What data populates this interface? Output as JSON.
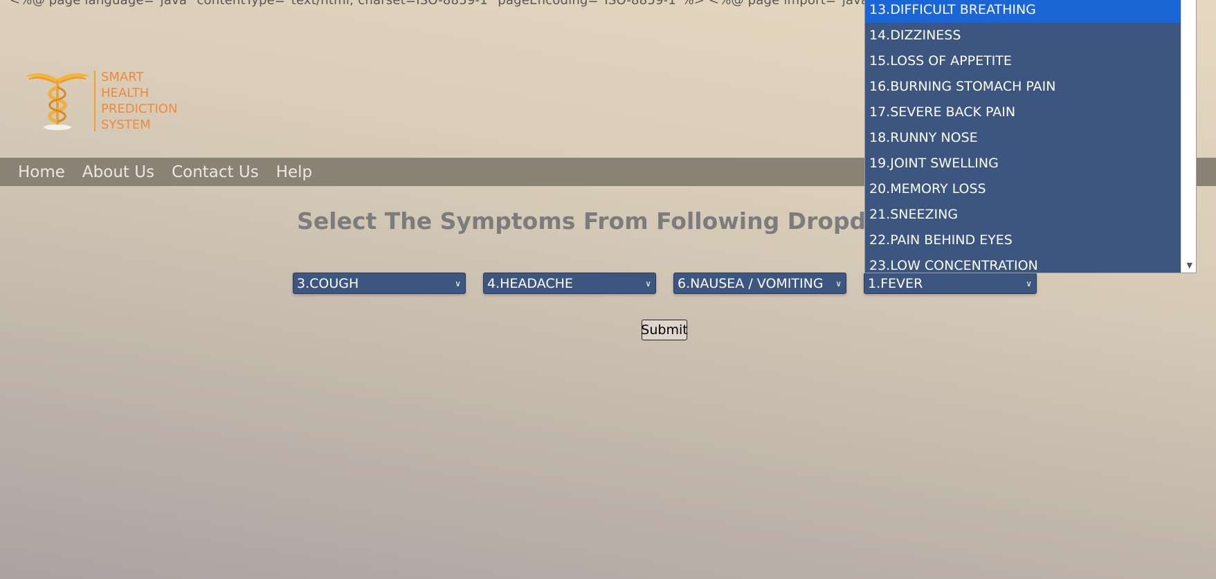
{
  "source_leak": "<%@ page language=\"java\" contentType=\"text/html; charset=ISO-8859-1\" pageEncoding=\"ISO-8859-1\"%>   <%@ page import=\"java.util.",
  "logo": {
    "line1": "SMART",
    "line2": "HEALTH",
    "line3": "PREDICTION",
    "line4": "SYSTEM",
    "accent_color": "#ef8a3a"
  },
  "nav": {
    "home": "Home",
    "about": "About Us",
    "contact": "Contact Us",
    "help": "Help"
  },
  "heading": "Select The Symptoms From Following Dropdown",
  "selects": [
    {
      "value": "3.COUGH"
    },
    {
      "value": "4.HEADACHE"
    },
    {
      "value": "6.NAUSEA / VOMITING"
    },
    {
      "value": "1.FEVER"
    }
  ],
  "submit_label": "Submit",
  "dropdown": {
    "options": [
      "13.DIFFICULT BREATHING",
      "14.DIZZINESS",
      "15.LOSS OF APPETITE",
      "16.BURNING STOMACH PAIN",
      "17.SEVERE BACK PAIN",
      "18.RUNNY NOSE",
      "19.JOINT SWELLING",
      "20.MEMORY LOSS",
      "21.SNEEZING",
      "22.PAIN BEHIND EYES",
      "23.LOW CONCENTRATION"
    ],
    "highlighted": "13.DIFFICULT BREATHING"
  },
  "colors": {
    "select_bg": "#3d5680",
    "highlight": "#1b66d6",
    "navbar": "#8a8275"
  },
  "icons": [
    "caduceus-logo-icon",
    "chevron-down-icon",
    "scroll-down-arrow-icon"
  ]
}
